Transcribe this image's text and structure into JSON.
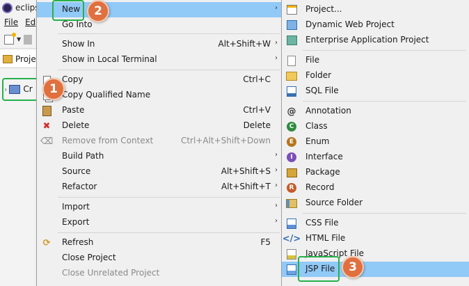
{
  "window": {
    "title": "eclips"
  },
  "menubar": {
    "items": [
      "File",
      "Ed"
    ]
  },
  "view": {
    "tab_label": "Proje"
  },
  "tree": {
    "item_label": "Cr"
  },
  "context_menu": {
    "items": [
      {
        "label": "New",
        "accel": "",
        "submenu": true,
        "icon": "",
        "selected": true,
        "disabled": false
      },
      {
        "label": "Go Into",
        "accel": "",
        "submenu": false,
        "icon": "",
        "disabled": false
      },
      {
        "label": "Show In",
        "accel": "Alt+Shift+W",
        "submenu": true,
        "icon": "",
        "disabled": false
      },
      {
        "label": "Show in Local Terminal",
        "accel": "",
        "submenu": true,
        "icon": "",
        "disabled": false
      },
      {
        "label": "Copy",
        "accel": "Ctrl+C",
        "submenu": false,
        "icon": "copy-icon",
        "disabled": false
      },
      {
        "label": "Copy Qualified Name",
        "accel": "",
        "submenu": false,
        "icon": "",
        "disabled": false
      },
      {
        "label": "Paste",
        "accel": "Ctrl+V",
        "submenu": false,
        "icon": "paste-icon",
        "disabled": false
      },
      {
        "label": "Delete",
        "accel": "Delete",
        "submenu": false,
        "icon": "delete-icon",
        "disabled": false
      },
      {
        "label": "Remove from Context",
        "accel": "Ctrl+Alt+Shift+Down",
        "submenu": false,
        "icon": "remove-context-icon",
        "disabled": true
      },
      {
        "label": "Build Path",
        "accel": "",
        "submenu": true,
        "icon": "",
        "disabled": false
      },
      {
        "label": "Source",
        "accel": "Alt+Shift+S",
        "submenu": true,
        "icon": "",
        "disabled": false
      },
      {
        "label": "Refactor",
        "accel": "Alt+Shift+T",
        "submenu": true,
        "icon": "",
        "disabled": false
      },
      {
        "label": "Import",
        "accel": "",
        "submenu": true,
        "icon": "",
        "disabled": false
      },
      {
        "label": "Export",
        "accel": "",
        "submenu": true,
        "icon": "",
        "disabled": false
      },
      {
        "label": "Refresh",
        "accel": "F5",
        "submenu": false,
        "icon": "refresh-icon",
        "disabled": false
      },
      {
        "label": "Close Project",
        "accel": "",
        "submenu": false,
        "icon": "",
        "disabled": false
      },
      {
        "label": "Close Unrelated Project",
        "accel": "",
        "submenu": false,
        "icon": "",
        "disabled": true
      }
    ]
  },
  "new_submenu": {
    "items": [
      {
        "label": "Project...",
        "icon": "project-icon"
      },
      {
        "label": "Dynamic Web Project",
        "icon": "dynamic-web-project-icon"
      },
      {
        "label": "Enterprise Application Project",
        "icon": "enterprise-app-project-icon"
      },
      {
        "label": "File",
        "icon": "file-icon"
      },
      {
        "label": "Folder",
        "icon": "folder-icon"
      },
      {
        "label": "SQL File",
        "icon": "sql-file-icon"
      },
      {
        "label": "Annotation",
        "icon": "annotation-icon"
      },
      {
        "label": "Class",
        "icon": "class-icon"
      },
      {
        "label": "Enum",
        "icon": "enum-icon"
      },
      {
        "label": "Interface",
        "icon": "interface-icon"
      },
      {
        "label": "Package",
        "icon": "package-icon"
      },
      {
        "label": "Record",
        "icon": "record-icon"
      },
      {
        "label": "Source Folder",
        "icon": "source-folder-icon"
      },
      {
        "label": "CSS File",
        "icon": "css-file-icon"
      },
      {
        "label": "HTML File",
        "icon": "html-file-icon"
      },
      {
        "label": "JavaScript File",
        "icon": "javascript-file-icon"
      },
      {
        "label": "JSP File",
        "icon": "jsp-file-icon",
        "selected": true
      }
    ]
  },
  "callouts": [
    "1",
    "2",
    "3"
  ],
  "colors": {
    "menu_bg": "#f0f0f0",
    "selection": "#91c9f7",
    "highlight_box": "#27b04b",
    "callout_badge": "#e0703f",
    "disabled_text": "#8a8a8a"
  }
}
